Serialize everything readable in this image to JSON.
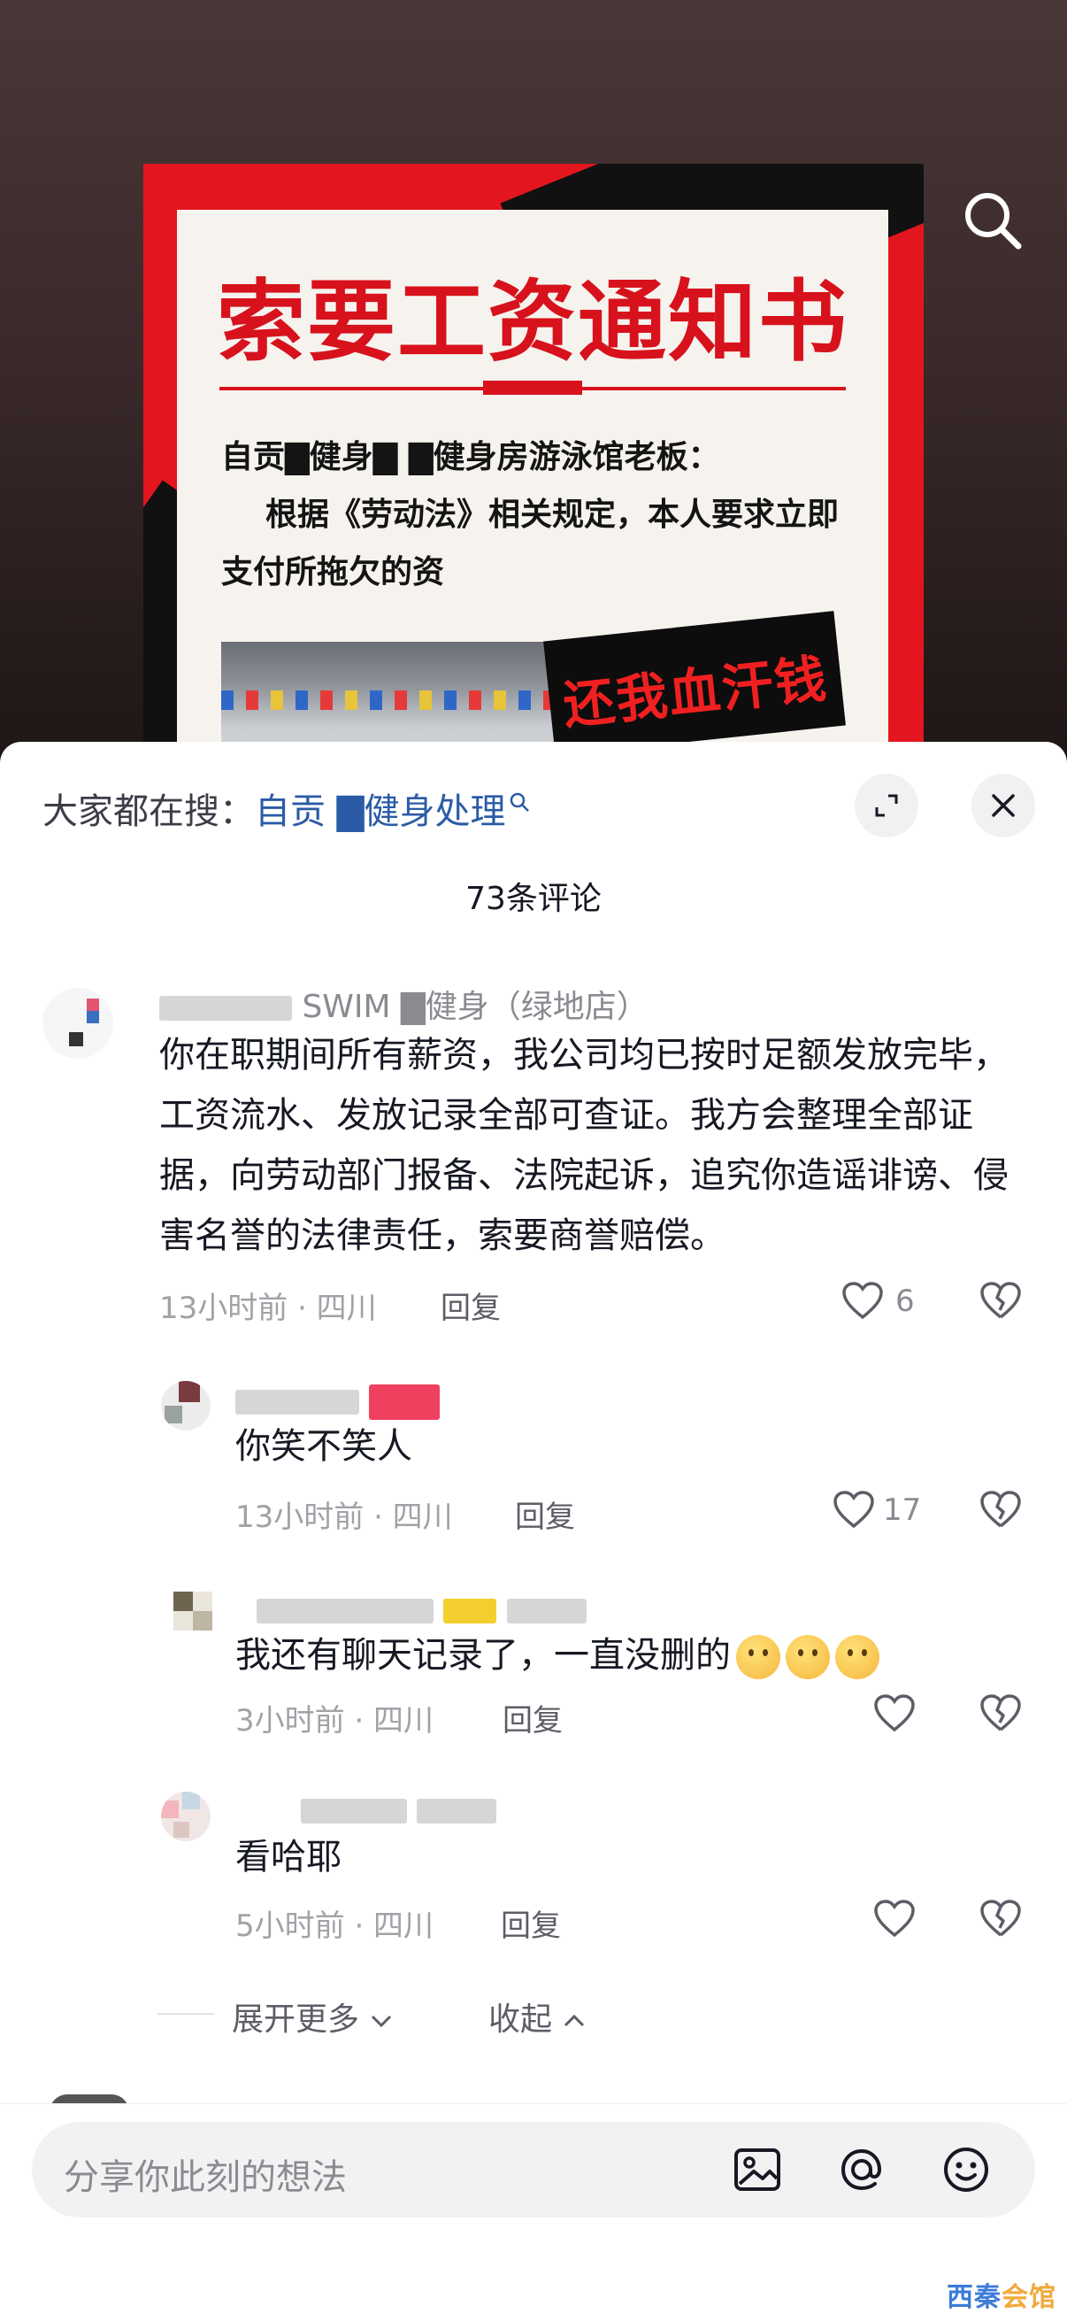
{
  "poster": {
    "title": "索要工资通知书",
    "line1": "自贡▇健身▇ ▇健身房游泳馆老板：",
    "line2": "根据《劳动法》相关规定，本人要求立即",
    "line3": "支付所拖欠的资",
    "sign": "还我血汗钱"
  },
  "header": {
    "hot_search_prefix": "大家都在搜：",
    "hot_search_query": "自贡 ▇健身处理",
    "comment_count": "73条评论"
  },
  "comments": [
    {
      "name": "SWIM ▇健身（绿地店）",
      "text": "你在职期间所有薪资，我公司均已按时足额发放完毕，工资流水、发放记录全部可查证。我方会整理全部证据，向劳动部门报备、法院起诉，追究你造谣诽谤、侵害名誉的法律责任，索要商誉赔偿。",
      "time": "13小时前 · 四川",
      "reply": "回复",
      "likes": "6"
    },
    {
      "text": "你笑不笑人",
      "time": "13小时前 · 四川",
      "reply": "回复",
      "likes": "17"
    },
    {
      "text": "我还有聊天记录了，一直没删的",
      "time": "3小时前 · 四川",
      "reply": "回复",
      "likes": ""
    },
    {
      "text": "看哈耶",
      "time": "5小时前 · 四川",
      "reply": "回复",
      "likes": ""
    }
  ],
  "thread": {
    "expand_more": "展开更多",
    "collapse": "收起"
  },
  "input": {
    "placeholder": "分享你此刻的想法"
  },
  "watermark": {
    "part1": "西秦",
    "part2": "会馆"
  },
  "icons": {
    "search": "search-icon",
    "expand": "expand-icon",
    "close": "close-icon",
    "like": "heart-outline-icon",
    "dislike": "broken-heart-icon",
    "image": "image-icon",
    "mention": "at-icon",
    "emoji": "emoji-icon"
  },
  "colors": {
    "accent_link": "#2b5ba6",
    "poster_red": "#d7121d",
    "secondary_text": "#8a8b91"
  }
}
